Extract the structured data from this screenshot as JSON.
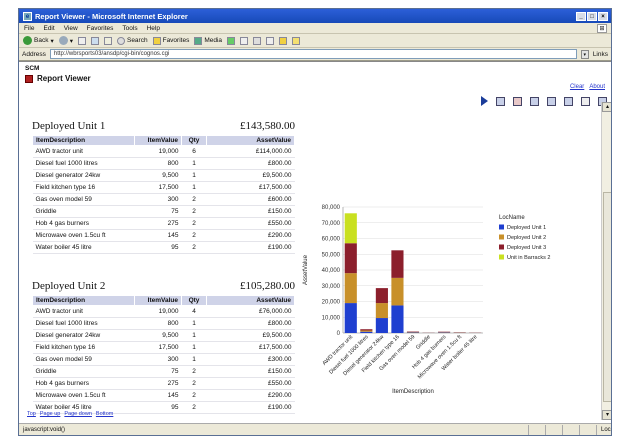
{
  "window": {
    "title": "Report Viewer - Microsoft Internet Explorer",
    "min": "_",
    "max": "□",
    "close": "×"
  },
  "menu": [
    "File",
    "Edit",
    "View",
    "Favorites",
    "Tools",
    "Help"
  ],
  "toolbar": {
    "back": "Back",
    "search": "Search",
    "favorites": "Favorites",
    "media": "Media"
  },
  "address": {
    "label": "Address",
    "url": "http://wbrsports03/ansdp/cgi-bin/cognos.cgi",
    "links": "Links"
  },
  "page": {
    "scm": "SCM",
    "title": "Report Viewer",
    "clear": "Clear",
    "about": "About"
  },
  "reports": [
    {
      "name": "Deployed Unit 1",
      "total": "£143,580.00",
      "headers": [
        "ItemDescription",
        "ItemValue",
        "Qty",
        "AssetValue"
      ],
      "rows": [
        [
          "AWD tractor unit",
          "19,000",
          "6",
          "£114,000.00"
        ],
        [
          "Diesel fuel 1000 litres",
          "800",
          "1",
          "£800.00"
        ],
        [
          "Diesel generator 24kw",
          "9,500",
          "1",
          "£9,500.00"
        ],
        [
          "Field kitchen type 16",
          "17,500",
          "1",
          "£17,500.00"
        ],
        [
          "Gas oven model 59",
          "300",
          "2",
          "£600.00"
        ],
        [
          "Griddle",
          "75",
          "2",
          "£150.00"
        ],
        [
          "Hob 4 gas burners",
          "275",
          "2",
          "£550.00"
        ],
        [
          "Microwave oven 1.5cu ft",
          "145",
          "2",
          "£290.00"
        ],
        [
          "Water boiler 45 litre",
          "95",
          "2",
          "£190.00"
        ]
      ]
    },
    {
      "name": "Deployed Unit 2",
      "total": "£105,280.00",
      "headers": [
        "ItemDescription",
        "ItemValue",
        "Qty",
        "AssetValue"
      ],
      "rows": [
        [
          "AWD tractor unit",
          "19,000",
          "4",
          "£76,000.00"
        ],
        [
          "Diesel fuel 1000 litres",
          "800",
          "1",
          "£800.00"
        ],
        [
          "Diesel generator 24kw",
          "9,500",
          "1",
          "£9,500.00"
        ],
        [
          "Field kitchen type 16",
          "17,500",
          "1",
          "£17,500.00"
        ],
        [
          "Gas oven model 59",
          "300",
          "1",
          "£300.00"
        ],
        [
          "Griddle",
          "75",
          "2",
          "£150.00"
        ],
        [
          "Hob 4 gas burners",
          "275",
          "2",
          "£550.00"
        ],
        [
          "Microwave oven 1.5cu ft",
          "145",
          "2",
          "£290.00"
        ],
        [
          "Water boiler 45 litre",
          "95",
          "2",
          "£190.00"
        ]
      ]
    }
  ],
  "bottom_nav": {
    "top": "Top",
    "page_up": "Page up",
    "page_down": "Page down",
    "bottom": "Bottom"
  },
  "status": {
    "text": "javascript:void()",
    "zone": "Local intranet"
  },
  "chart_data": {
    "type": "bar",
    "stacked": true,
    "xlabel": "ItemDescription",
    "ylabel": "AssetValue",
    "ylim": [
      0,
      80000
    ],
    "yticks": [
      "0",
      "10,000",
      "20,000",
      "30,000",
      "40,000",
      "50,000",
      "60,000",
      "70,000",
      "80,000"
    ],
    "legend_title": "LocName",
    "legend_position": "right",
    "categories": [
      "AWD tractor unit",
      "Diesel fuel 1000 litres",
      "Diesel generator 24kw",
      "Field kitchen type 16",
      "Gas oven model 59",
      "Griddle",
      "Hob 4 gas burners",
      "Microwave oven 1.5cu ft",
      "Water boiler 45 litre"
    ],
    "series": [
      {
        "name": "Deployed Unit 1",
        "color": "#1f3fd0",
        "values": [
          19000,
          800,
          9500,
          17500,
          300,
          75,
          275,
          145,
          95
        ]
      },
      {
        "name": "Deployed Unit 2",
        "color": "#c8902a",
        "values": [
          19000,
          800,
          9500,
          17500,
          300,
          75,
          275,
          145,
          95
        ]
      },
      {
        "name": "Deployed Unit 3",
        "color": "#8c1f2c",
        "values": [
          19000,
          800,
          9500,
          17500,
          300,
          75,
          275,
          145,
          95
        ]
      },
      {
        "name": "Unit in Barracks 2",
        "color": "#c9e020",
        "values": [
          19000,
          0,
          0,
          0,
          0,
          0,
          0,
          0,
          0
        ]
      }
    ]
  }
}
